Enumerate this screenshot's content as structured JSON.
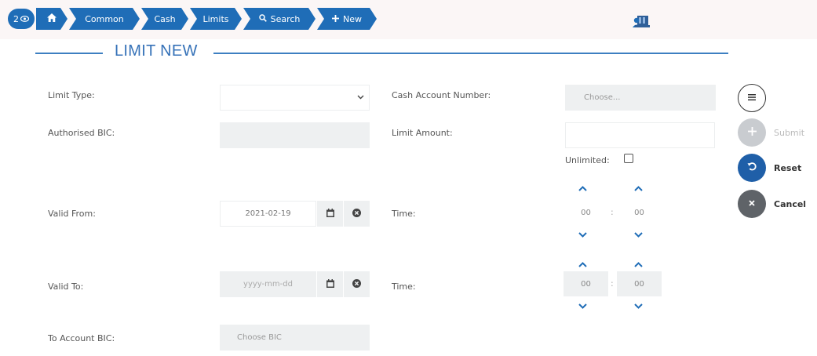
{
  "breadcrumb": {
    "count": "2",
    "count_icon": "eye-icon",
    "items": [
      {
        "label": "",
        "icon": "home-icon"
      },
      {
        "label": "Common"
      },
      {
        "label": "Cash"
      },
      {
        "label": "Limits"
      },
      {
        "label": "Search",
        "icon": "search-icon"
      },
      {
        "label": "New",
        "icon": "plus-icon"
      }
    ]
  },
  "header": {
    "user_icon": "user-bank-icon"
  },
  "section": {
    "title": "LIMIT NEW"
  },
  "form": {
    "limit_type": {
      "label": "Limit Type:",
      "value": ""
    },
    "cash_account_number": {
      "label": "Cash Account Number:",
      "placeholder": "Choose..."
    },
    "authorised_bic": {
      "label": "Authorised BIC:",
      "value": ""
    },
    "limit_amount": {
      "label": "Limit Amount:",
      "value": ""
    },
    "unlimited": {
      "label": "Unlimited:",
      "checked": false
    },
    "valid_from": {
      "label": "Valid From:",
      "value": "2021-02-19"
    },
    "valid_from_time": {
      "label": "Time:",
      "hour": "00",
      "minute": "00",
      "separator": ":"
    },
    "valid_to": {
      "label": "Valid To:",
      "placeholder": "yyyy-mm-dd"
    },
    "valid_to_time": {
      "label": "Time:",
      "hour": "00",
      "minute": "00",
      "separator": ":"
    },
    "to_account_bic": {
      "label": "To Account BIC:",
      "placeholder": "Choose BIC"
    }
  },
  "actions": {
    "menu_icon": "menu-icon",
    "submit": "Submit",
    "reset": "Reset",
    "cancel": "Cancel"
  },
  "colors": {
    "primary": "#1f6db7",
    "required_red": "#c0392b",
    "valid_green": "#3aa845",
    "disabled_gray": "#c9ccd0",
    "cancel_gray": "#5f6368"
  }
}
